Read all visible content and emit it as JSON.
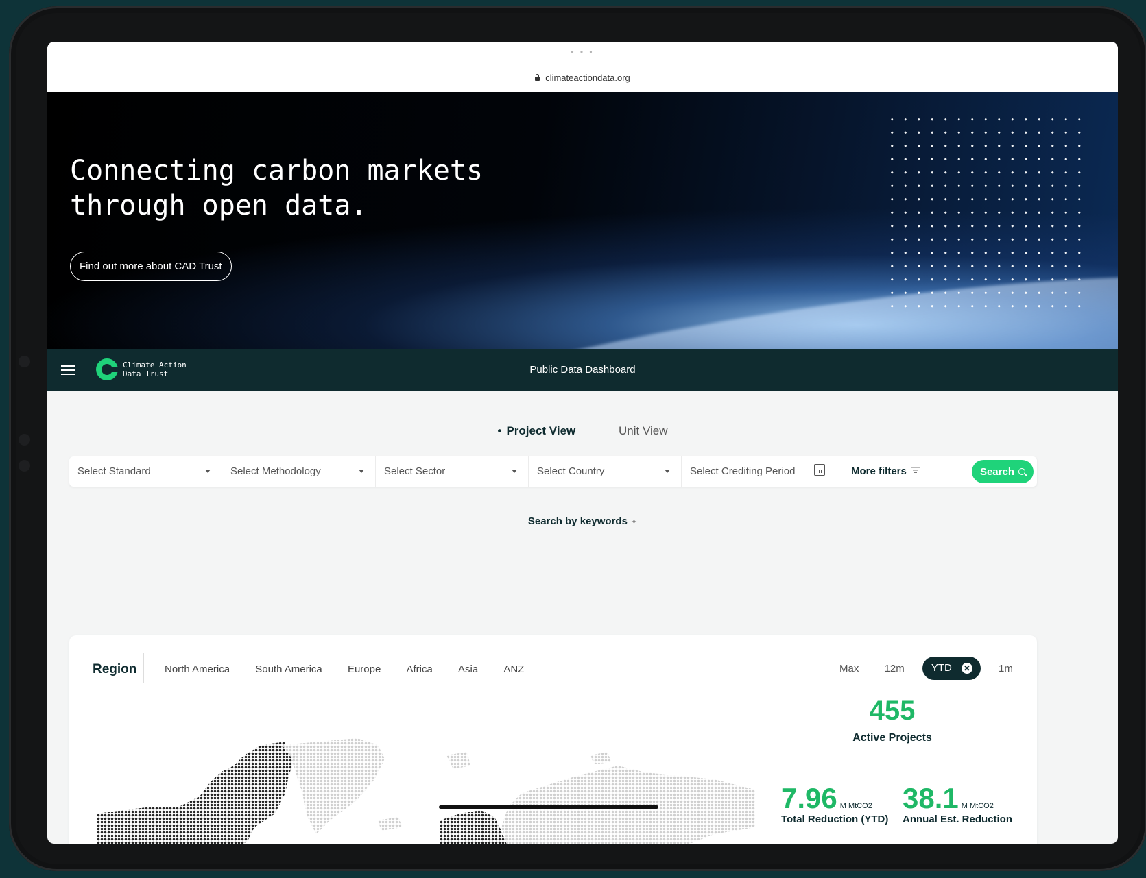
{
  "browser": {
    "dots": "• • •",
    "url": "climateactiondata.org"
  },
  "hero": {
    "title_line1": "Connecting carbon markets",
    "title_line2": "through open data.",
    "cta_label": "Find out more about CAD Trust"
  },
  "navbar": {
    "logo_line1": "Climate Action",
    "logo_line2": "Data Trust",
    "title": "Public Data Dashboard"
  },
  "view_tabs": {
    "project": "Project View",
    "unit": "Unit View",
    "active": "Project View"
  },
  "filters": {
    "standard": "Select Standard",
    "methodology": "Select Methodology",
    "sector": "Select Sector",
    "country": "Select Country",
    "crediting_period": "Select Crediting Period",
    "more_filters": "More filters",
    "search": "Search"
  },
  "keyword_search": "Search by keywords",
  "region": {
    "label": "Region",
    "tabs": [
      "North America",
      "South America",
      "Europe",
      "Africa",
      "Asia",
      "ANZ"
    ]
  },
  "period": {
    "tabs": [
      "Max",
      "12m",
      "YTD",
      "1m"
    ],
    "active": "YTD"
  },
  "stats": {
    "active_projects": {
      "value": "455",
      "label": "Active Projects"
    },
    "total_reduction": {
      "value": "7.96",
      "unit": "M MtCO2",
      "label": "Total Reduction (YTD)"
    },
    "annual_reduction": {
      "value": "38.1",
      "unit": "M MtCO2",
      "label": "Annual Est. Reduction"
    }
  },
  "colors": {
    "accent": "#1fd37a",
    "navy": "#0f2b2f",
    "stat_green": "#1fb866"
  },
  "icons": [
    "lock-icon",
    "hamburger-icon",
    "logo-icon",
    "caret-down-icon",
    "calendar-icon",
    "filter-icon",
    "search-icon",
    "sparkle-icon",
    "close-icon"
  ]
}
